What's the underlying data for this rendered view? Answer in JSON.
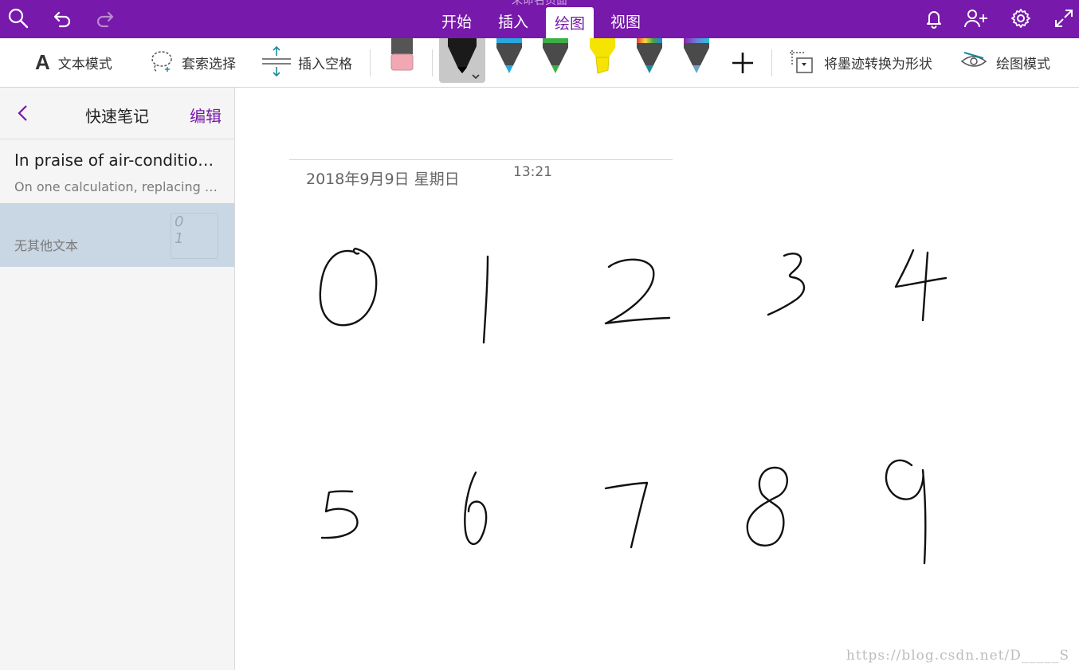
{
  "window": {
    "title": "未命名页面"
  },
  "tabs": [
    {
      "label": "开始",
      "active": false
    },
    {
      "label": "插入",
      "active": false
    },
    {
      "label": "绘图",
      "active": true
    },
    {
      "label": "视图",
      "active": false
    }
  ],
  "topbar_icons": [
    "search-icon",
    "undo-icon",
    "redo-icon",
    "bell-icon",
    "add-person-icon",
    "gear-icon",
    "expand-icon"
  ],
  "ribbon": {
    "text_mode": "文本模式",
    "lasso_select": "套索选择",
    "insert_space": "插入空格",
    "ink_to_shape": "将墨迹转换为形状",
    "draw_mode": "绘图模式",
    "pens": [
      {
        "name": "eraser",
        "color": "#f2a8b4"
      },
      {
        "name": "black-pen",
        "color": "#111111",
        "selected": true
      },
      {
        "name": "blue-pen",
        "color": "#29a8e0"
      },
      {
        "name": "green-pen",
        "color": "#3cb043"
      },
      {
        "name": "yellow-highlighter",
        "color": "#f5e400"
      },
      {
        "name": "rainbow-pen",
        "color": "#d94f8c"
      },
      {
        "name": "galaxy-pen",
        "color": "#6a7fd8"
      }
    ]
  },
  "sidebar": {
    "title": "快速笔记",
    "edit": "编辑",
    "notes": [
      {
        "title": "In praise of air-conditioning",
        "preview": "On one calculation, replacing air-conditioning",
        "selected": false
      },
      {
        "title": "",
        "preview": "无其他文本",
        "selected": true,
        "thumb_text": "0 1"
      }
    ]
  },
  "page": {
    "date": "2018年9月9日 星期日",
    "time": "13:21",
    "handwritten_digits": [
      "0",
      "1",
      "2",
      "3",
      "4",
      "5",
      "6",
      "7",
      "8",
      "9"
    ]
  },
  "watermark": "https://blog.csdn.net/D_____S",
  "colors": {
    "accent": "#7719aa",
    "selection": "#c9d6e3"
  }
}
